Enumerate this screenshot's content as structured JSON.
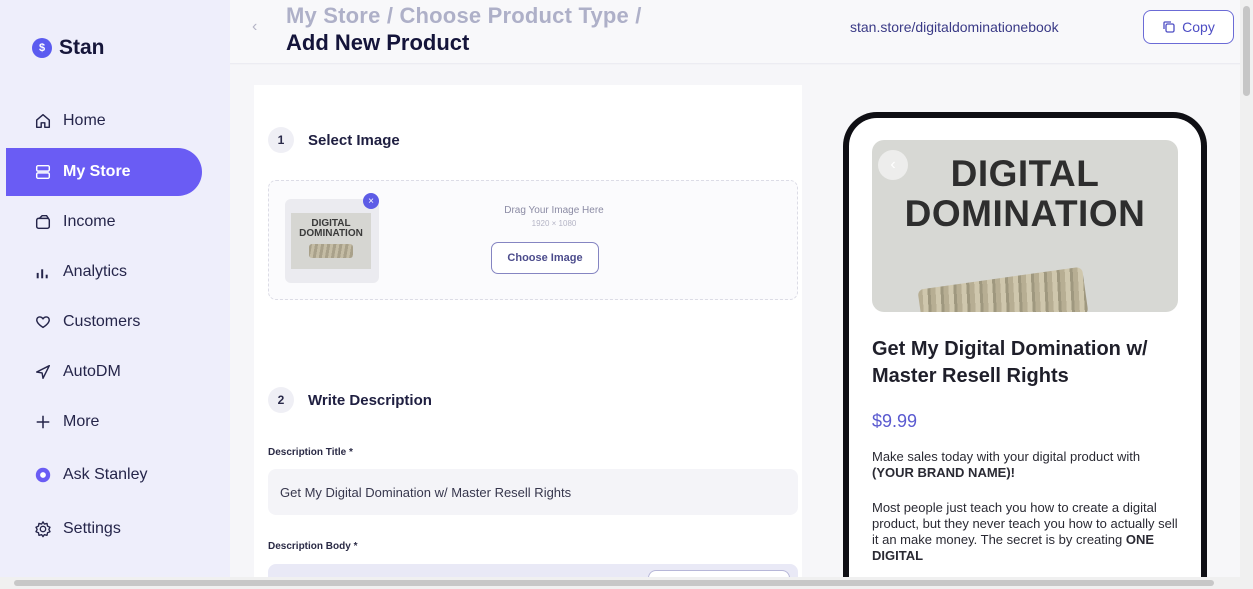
{
  "brand": {
    "logo_glyph": "$",
    "name": "Stan"
  },
  "sidebar": {
    "items": [
      {
        "label": "Home",
        "icon": "home-icon"
      },
      {
        "label": "My Store",
        "icon": "store-icon",
        "active": true
      },
      {
        "label": "Income",
        "icon": "wallet-icon"
      },
      {
        "label": "Analytics",
        "icon": "analytics-icon"
      },
      {
        "label": "Customers",
        "icon": "heart-icon"
      },
      {
        "label": "AutoDM",
        "icon": "send-icon"
      },
      {
        "label": "More",
        "icon": "plus-icon"
      },
      {
        "label": "Ask Stanley",
        "icon": "stanley-icon"
      },
      {
        "label": "Settings",
        "icon": "gear-icon"
      }
    ]
  },
  "header": {
    "back_glyph": "‹",
    "breadcrumb": "My Store / Choose Product Type /",
    "title": "Add New Product",
    "store_url": "stan.store/digitaldominationebook",
    "copy_label": "Copy"
  },
  "editor": {
    "step1": {
      "num": "1",
      "title": "Select Image"
    },
    "thumb_text": "DIGITAL DOMINATION",
    "remove_glyph": "×",
    "drag_label": "Drag Your Image Here",
    "drag_size": "1920 × 1080",
    "choose_label": "Choose Image",
    "step2": {
      "num": "2",
      "title": "Write Description"
    },
    "desc_title_label": "Description Title *",
    "desc_title_value": "Get My Digital Domination w/ Master Resell Rights",
    "desc_body_label": "Description Body *"
  },
  "preview": {
    "back_glyph": "‹",
    "hero_line1": "DIGITAL",
    "hero_line2": "DOMINATION",
    "product_title": "Get My Digital Domination w/ Master Resell Rights",
    "price": "$9.99",
    "desc1_pre": "Make sales today with your digital product with ",
    "desc1_bold": "(YOUR BRAND NAME)!",
    "desc2_pre": "Most people just teach you how to create a digital product, but they never teach you how to actually sell it an make money. The secret is by creating ",
    "desc2_bold": "ONE DIGITAL"
  },
  "colors": {
    "accent": "#6a5cf4",
    "sidebar_bg": "#eeeefb",
    "price": "#5a5ad0"
  }
}
